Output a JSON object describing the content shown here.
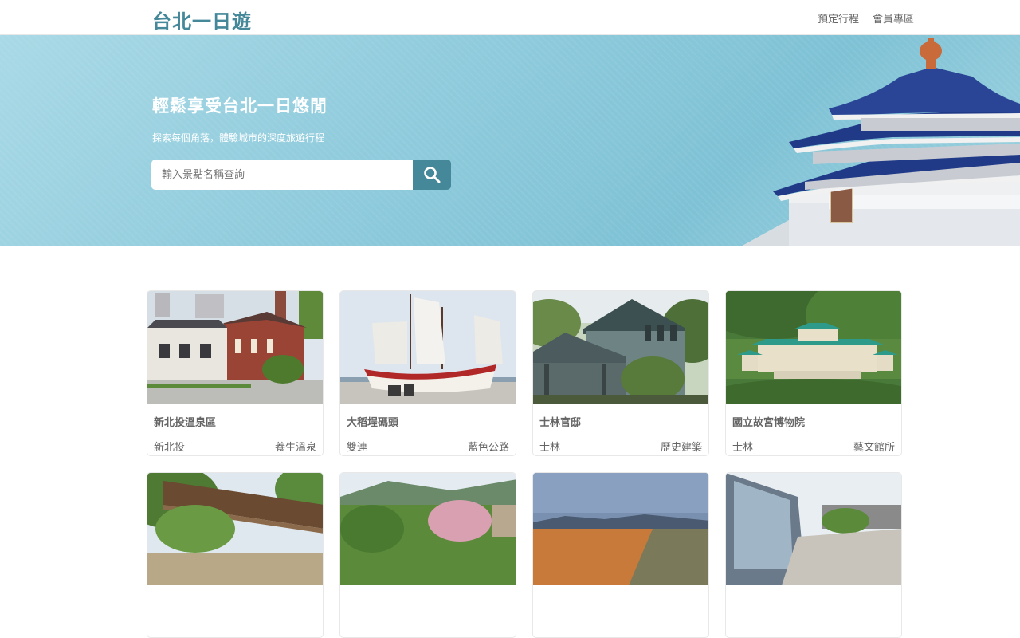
{
  "nav": {
    "brand": "台北一日遊",
    "links": [
      "預定行程",
      "會員專區"
    ]
  },
  "hero": {
    "title": "輕鬆享受台北一日悠閒",
    "subtitle": "探索每個角落，體驗城市的深度旅遊行程",
    "search_placeholder": "輸入景點名稱查詢"
  },
  "attractions": [
    {
      "name": "新北投溫泉區",
      "mrt": "新北投",
      "category": "養生溫泉"
    },
    {
      "name": "大稻埕碼頭",
      "mrt": "雙連",
      "category": "藍色公路"
    },
    {
      "name": "士林官邸",
      "mrt": "士林",
      "category": "歷史建築"
    },
    {
      "name": "國立故宮博物院",
      "mrt": "士林",
      "category": "藝文館所"
    }
  ],
  "colors": {
    "brand": "#448899",
    "text": "#666666",
    "hero_bg": "#8fcbdc"
  }
}
